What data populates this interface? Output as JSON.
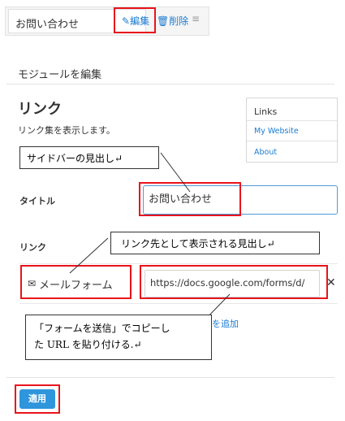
{
  "widget_row": {
    "widget_name": "お問い合わせ",
    "edit_label": "編集",
    "edit_icon": "pencil-icon",
    "delete_label": "削除",
    "delete_icon": "trash-icon",
    "drag_icon": "drag-handle-icon"
  },
  "modal": {
    "title": "モジュールを編集",
    "module_heading": "リンク",
    "module_description": "リンク集を表示します。",
    "preview": {
      "title": "Links",
      "links": [
        "My Website",
        "About"
      ]
    },
    "fields": {
      "title_label": "タイトル",
      "title_value": "お問い合わせ",
      "links_label": "リンク",
      "link_name_value": "メールフォーム",
      "link_name_icon": "envelope-icon",
      "link_url_value": "https://docs.google.com/forms/d/",
      "remove_icon": "close-icon",
      "add_link_partial": "を追加"
    },
    "apply_label": "適用"
  },
  "annotations": {
    "callout_heading": "サイドバーの見出し↵",
    "callout_link_text": "リンク先として表示される見出し↵",
    "callout_url_line1": "「フォームを送信」でコピーし",
    "callout_url_line2": "た URL を貼り付ける.↵"
  },
  "colors": {
    "accent": "#1a7bd1",
    "annotation_red": "#e8141c",
    "apply_button": "#2f95dc",
    "focus_border": "#4f9ad8"
  }
}
